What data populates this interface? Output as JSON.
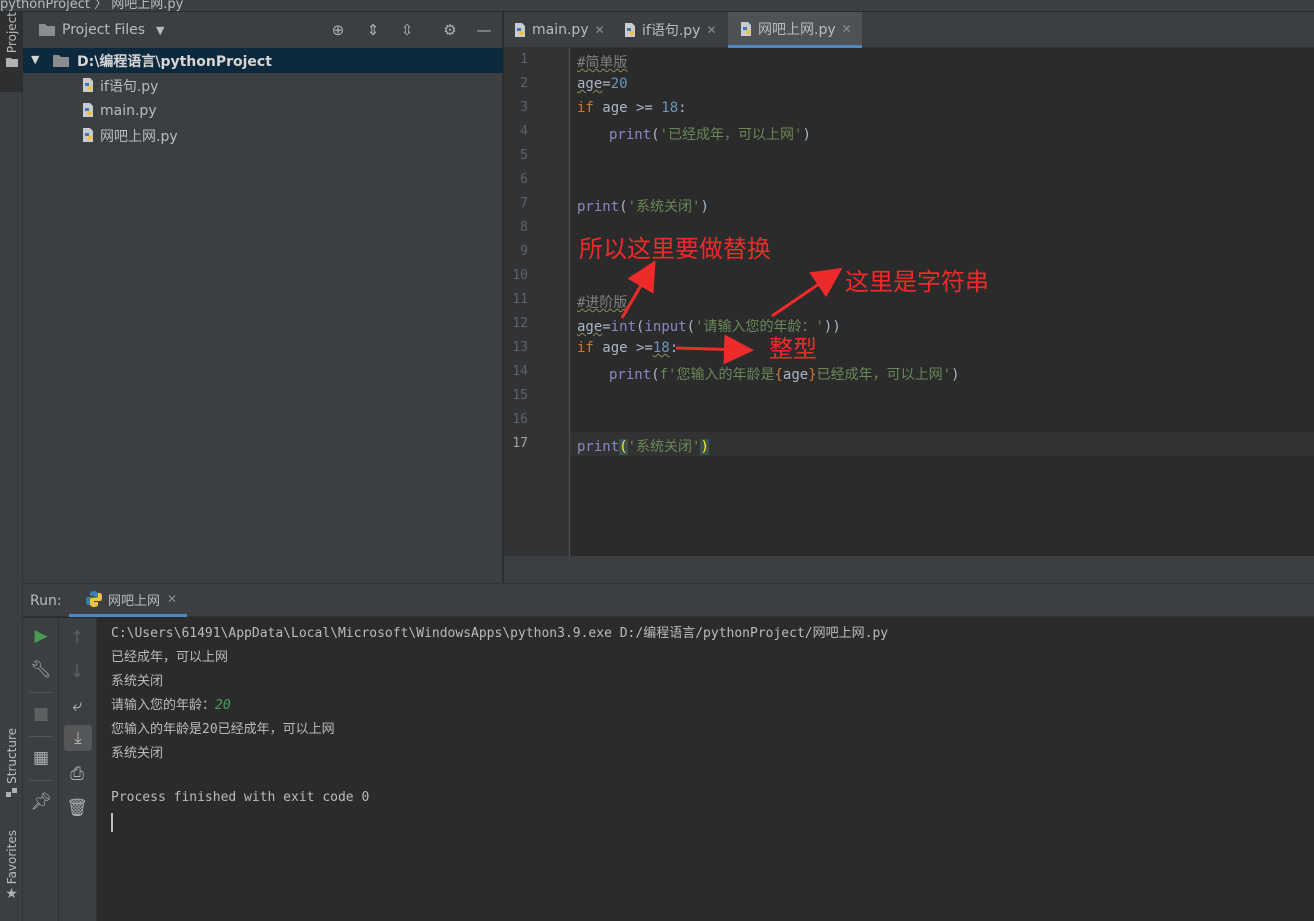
{
  "breadcrumb": {
    "text": "pythonProject  〉 网吧上网.py"
  },
  "left_stripe": {
    "project": "Project",
    "structure": "Structure",
    "favorites": "Favorites"
  },
  "project_panel": {
    "title": "Project Files",
    "root": "D:\\编程语言\\pythonProject",
    "files": [
      "if语句.py",
      "main.py",
      "网吧上网.py"
    ]
  },
  "editor": {
    "tabs": [
      {
        "label": "main.py"
      },
      {
        "label": "if语句.py"
      },
      {
        "label": "网吧上网.py",
        "active": true
      }
    ],
    "current_line": 17,
    "line_numbers": [
      "1",
      "2",
      "3",
      "4",
      "5",
      "6",
      "7",
      "8",
      "9",
      "10",
      "11",
      "12",
      "13",
      "14",
      "15",
      "16",
      "17"
    ],
    "code": {
      "l1": "#简单版",
      "l2_var": "age",
      "l2_eq": "=",
      "l2_num": "20",
      "l3_kw": "if",
      "l3_rest": " age >= ",
      "l3_num": "18",
      "l3_colon": ":",
      "l4_fn": "print",
      "l4_str": "'已经成年，可以上网'",
      "l7_fn": "print",
      "l7_str": "'系统关闭'",
      "l11": "#进阶版",
      "l12_var": "age",
      "l12_eq": "=",
      "l12_int": "int",
      "l12_input": "input",
      "l12_str": "'请输入您的年龄：'",
      "l13_kw": "if",
      "l13_rest": " age >=",
      "l13_num": "18",
      "l13_colon": ":",
      "l14_fn": "print",
      "l14_str1": "f'您输入的年龄是",
      "l14_var": "age",
      "l14_str2": "已经成年，可以上网'",
      "l17_fn": "print",
      "l17_str": "'系统关闭'"
    }
  },
  "annotations": {
    "replace": "所以这里要做替换",
    "string": "这里是字符串",
    "integer": "整型"
  },
  "run": {
    "label": "Run:",
    "tab": "网吧上网",
    "console": {
      "cmd": "C:\\Users\\61491\\AppData\\Local\\Microsoft\\WindowsApps\\python3.9.exe D:/编程语言/pythonProject/网吧上网.py",
      "out1": "已经成年，可以上网",
      "out2": "系统关闭",
      "prompt": "请输入您的年龄：",
      "input": "20",
      "out3": "您输入的年龄是20已经成年，可以上网",
      "out4": "系统关闭",
      "exit": "Process finished with exit code 0"
    }
  },
  "colors": {
    "keyword": "#cc7832",
    "number": "#6897bb",
    "string": "#6a8759",
    "comment": "#808080",
    "builtin": "#8888c6",
    "annotation": "#ee2b2b",
    "selection": "#0d293e"
  },
  "icons": {
    "folder": "folder-icon",
    "python_file": "python-file-icon",
    "locate": "crosshair-icon",
    "expand": "expand-all-icon",
    "collapse": "collapse-all-icon",
    "settings": "gear-icon",
    "hide": "minimize-icon",
    "run": "play-icon",
    "wrench": "wrench-icon",
    "stop": "stop-icon",
    "layout": "layout-icon",
    "pin": "pin-icon",
    "up": "arrow-up-icon",
    "down": "arrow-down-icon",
    "wrap": "soft-wrap-icon",
    "scroll_end": "scroll-to-end-icon",
    "print": "print-icon",
    "trash": "trash-icon"
  }
}
